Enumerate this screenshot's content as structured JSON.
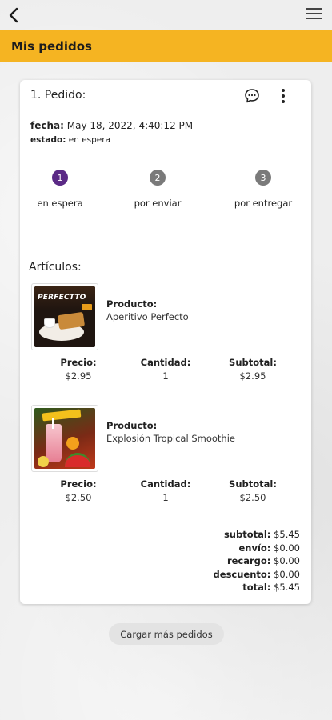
{
  "header": {
    "title": "Mis pedidos"
  },
  "icons": {
    "back": "chevron-left-icon",
    "menu": "hamburger-menu-icon",
    "chat": "chat-bubble-icon",
    "more": "more-vertical-icon"
  },
  "colors": {
    "accent": "#f5b422",
    "step_active": "#5b2a86",
    "step_inactive": "#7a7a7a"
  },
  "order": {
    "title": "1. Pedido:",
    "fecha_label": "fecha:",
    "fecha_value": "May 18, 2022, 4:40:12 PM",
    "estado_label": "estado:",
    "estado_value": "en espera",
    "steps": [
      {
        "number": "1",
        "label": "en espera",
        "active": true
      },
      {
        "number": "2",
        "label": "por enviar",
        "active": false
      },
      {
        "number": "3",
        "label": "por entregar",
        "active": false
      }
    ],
    "articles_title": "Artículos:",
    "products": [
      {
        "product_label": "Producto:",
        "name": "Aperitivo Perfecto",
        "image_text": "PERFECTTO",
        "price_label": "Precio:",
        "price": "$2.95",
        "qty_label": "Cantidad:",
        "qty": "1",
        "subtotal_label": "Subtotal:",
        "subtotal": "$2.95"
      },
      {
        "product_label": "Producto:",
        "name": "Explosión Tropical Smoothie",
        "price_label": "Precio:",
        "price": "$2.50",
        "qty_label": "Cantidad:",
        "qty": "1",
        "subtotal_label": "Subtotal:",
        "subtotal": "$2.50"
      }
    ],
    "totals": {
      "subtotal_label": "subtotal:",
      "subtotal": "$5.45",
      "envio_label": "envío:",
      "envio": "$0.00",
      "recargo_label": "recargo:",
      "recargo": "$0.00",
      "descuento_label": "descuento:",
      "descuento": "$0.00",
      "total_label": "total:",
      "total": "$5.45"
    }
  },
  "load_more_label": "Cargar más pedidos"
}
